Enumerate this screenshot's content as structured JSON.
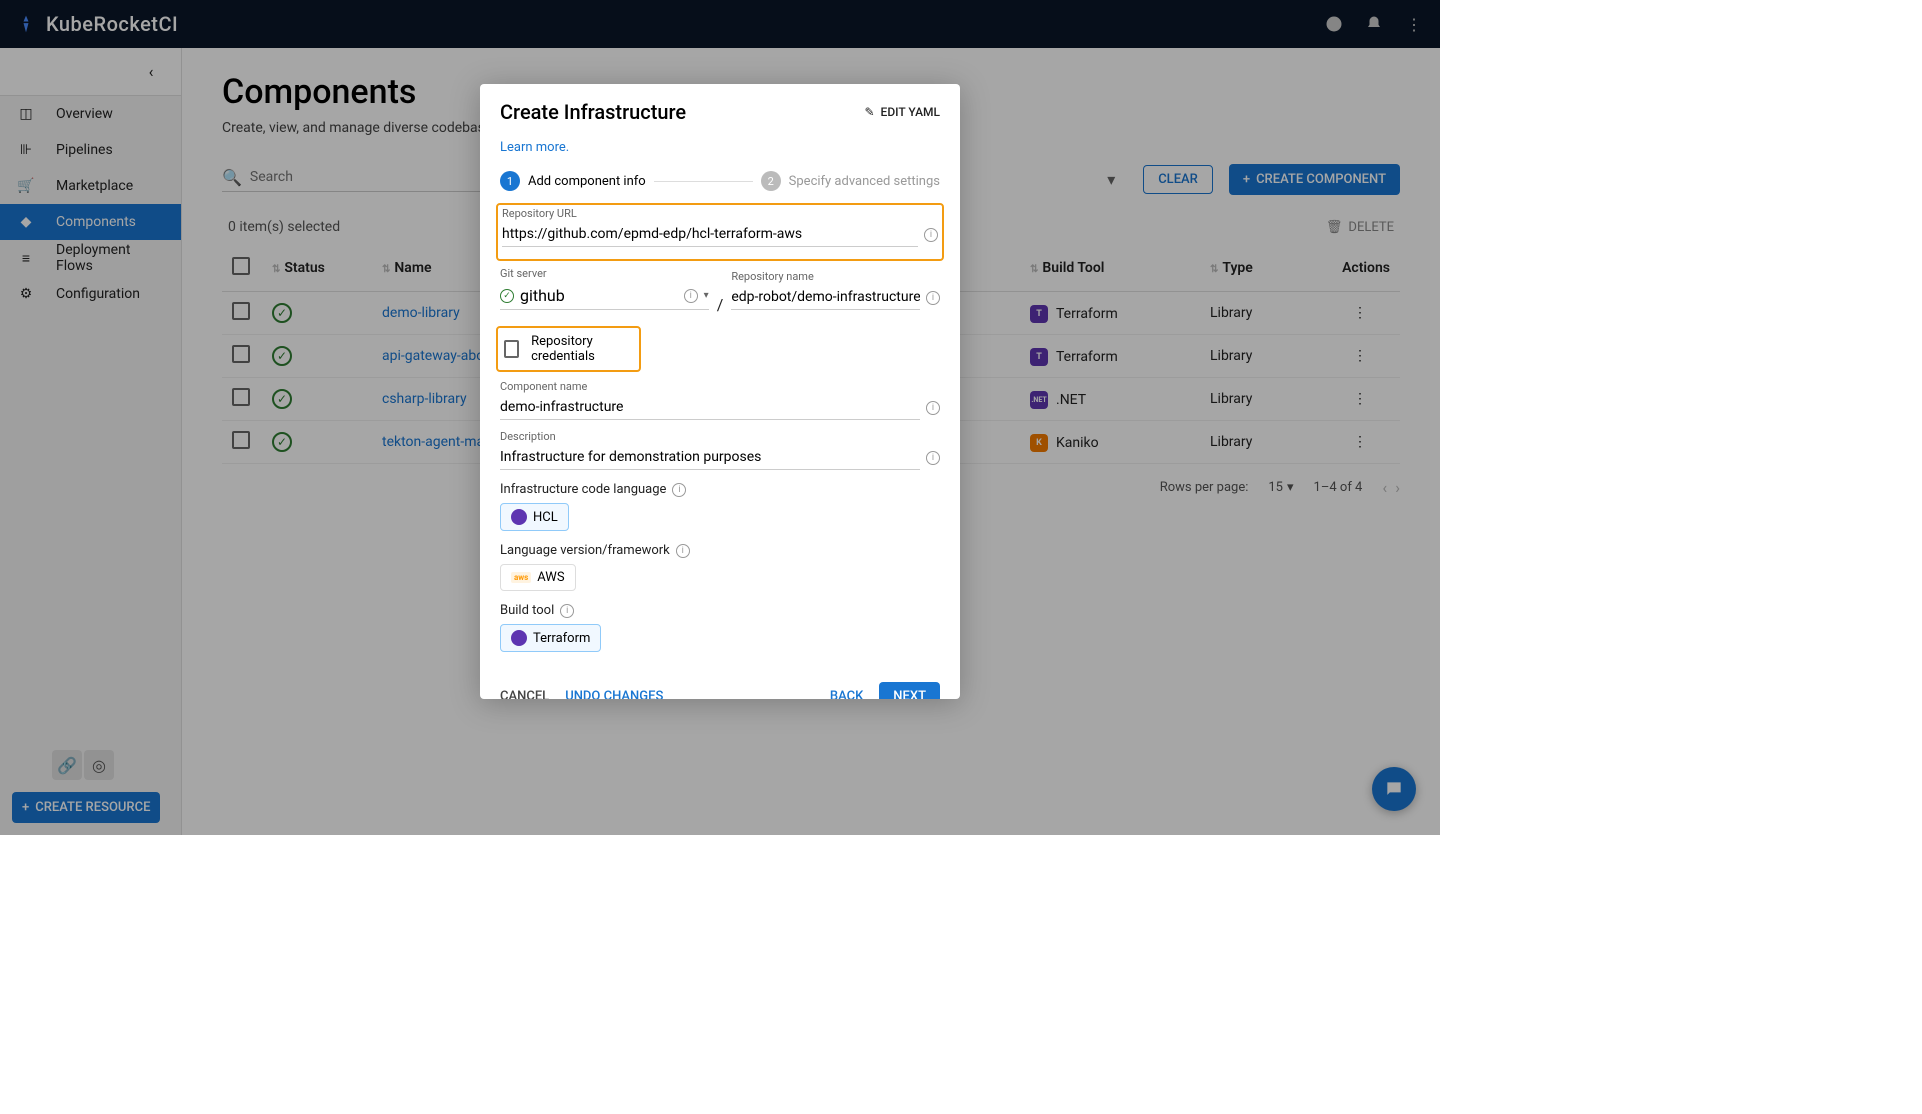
{
  "app": {
    "title": "KubeRocketCI"
  },
  "sidebar": {
    "items": [
      {
        "label": "Overview"
      },
      {
        "label": "Pipelines"
      },
      {
        "label": "Marketplace"
      },
      {
        "label": "Components"
      },
      {
        "label": "Deployment Flows"
      },
      {
        "label": "Configuration"
      }
    ],
    "create_resource": "CREATE RESOURCE"
  },
  "page": {
    "title": "Components",
    "subtitle": "Create, view, and manage diverse codebases, enco"
  },
  "toolbar": {
    "search_placeholder": "Search",
    "clear": "CLEAR",
    "create_component": "CREATE COMPONENT"
  },
  "selection": {
    "count_text": "0 item(s) selected",
    "delete": "DELETE"
  },
  "table": {
    "headers": {
      "status": "Status",
      "name": "Name",
      "build_tool": "Build Tool",
      "type": "Type",
      "actions": "Actions"
    },
    "rows": [
      {
        "name": "demo-library",
        "tool": "Terraform",
        "tool_badge": "tf",
        "type": "Library"
      },
      {
        "name": "api-gateway-abc",
        "tool": "Terraform",
        "tool_badge": "tf",
        "type": "Library"
      },
      {
        "name": "csharp-library",
        "tool": ".NET",
        "tool_badge": "net",
        "type": "Library"
      },
      {
        "name": "tekton-agent-ma",
        "tool": "Kaniko",
        "tool_badge": "k",
        "type": "Library"
      }
    ]
  },
  "pagination": {
    "rows_label": "Rows per page:",
    "rows": "15",
    "range": "1–4 of 4"
  },
  "modal": {
    "title": "Create Infrastructure",
    "edit_yaml": "EDIT YAML",
    "learn_more": "Learn more.",
    "step1": "Add component info",
    "step2": "Specify advanced settings",
    "fields": {
      "repo_url_label": "Repository URL",
      "repo_url": "https://github.com/epmd-edp/hcl-terraform-aws",
      "git_server_label": "Git server",
      "git_server": "github",
      "repo_name_label": "Repository name",
      "repo_name": "edp-robot/demo-infrastructure",
      "repo_creds": "Repository credentials",
      "comp_name_label": "Component name",
      "comp_name": "demo-infrastructure",
      "desc_label": "Description",
      "desc": "Infrastructure for demonstration purposes",
      "lang_label": "Infrastructure code language",
      "lang": "HCL",
      "fw_label": "Language version/framework",
      "fw": "AWS",
      "tool_label": "Build tool",
      "tool": "Terraform"
    },
    "buttons": {
      "cancel": "CANCEL",
      "undo": "UNDO CHANGES",
      "back": "BACK",
      "next": "NEXT"
    }
  }
}
